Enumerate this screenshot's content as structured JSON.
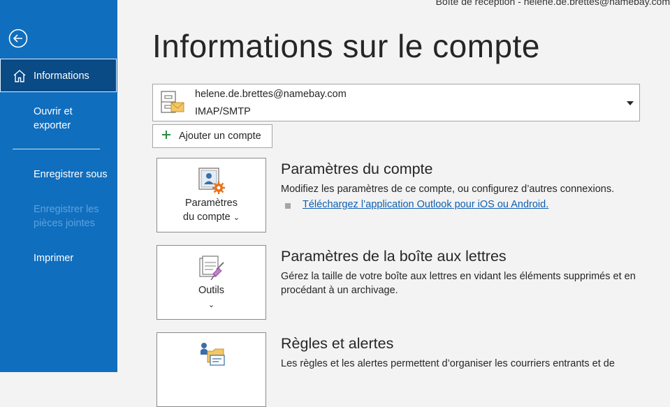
{
  "window": {
    "title": "Boîte de réception - helene.de.brettes@namebay.com"
  },
  "sidebar": {
    "back_icon": "back-arrow-icon",
    "items": [
      {
        "label": "Informations",
        "icon": "home-icon",
        "active": true
      },
      {
        "label": "Ouvrir et exporter"
      },
      {
        "label": "Enregistrer sous"
      },
      {
        "label": "Enregistrer les pièces jointes",
        "disabled": true
      },
      {
        "label": "Imprimer"
      }
    ]
  },
  "main": {
    "title": "Informations sur le compte",
    "account": {
      "email": "helene.de.brettes@namebay.com",
      "type": "IMAP/SMTP",
      "icon": "account-cabinet-icon"
    },
    "add_account_label": "Ajouter un compte",
    "sections": [
      {
        "button_label": "Paramètres du compte",
        "button_label_line1": "Paramètres",
        "button_label_line2": "du compte",
        "icon": "account-settings-icon",
        "title": "Paramètres du compte",
        "description": "Modifiez les paramètres de ce compte, ou configurez d’autres connexions.",
        "link": "Téléchargez l’application Outlook pour iOS ou Android."
      },
      {
        "button_label": "Outils",
        "icon": "tools-icon",
        "title": "Paramètres de la boîte aux lettres",
        "description": "Gérez la taille de votre boîte aux lettres en vidant les éléments supprimés et en procédant à un archivage."
      },
      {
        "icon": "rules-alerts-icon",
        "title": "Règles et alertes",
        "description": "Les règles et les alertes permettent d’organiser les courriers entrants et de"
      }
    ]
  },
  "colors": {
    "sidebar_bg": "#106ebe",
    "sidebar_active_bg": "#0a4a85",
    "link": "#0f5fae",
    "page_bg": "#f3f3f3"
  }
}
